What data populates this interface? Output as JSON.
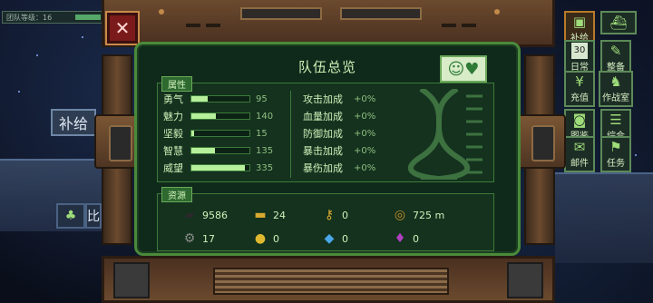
{
  "team": {
    "label": "团队等级：16",
    "progress": 0.35
  },
  "left_tab": {
    "label": "补给"
  },
  "side_glyph": "比",
  "panel": {
    "title": "队伍总览"
  },
  "attributes": {
    "tag": "属性",
    "items": [
      {
        "name": "勇气",
        "value": "95",
        "fill": 0.28
      },
      {
        "name": "魅力",
        "value": "140",
        "fill": 0.42
      },
      {
        "name": "坚毅",
        "value": "15",
        "fill": 0.05
      },
      {
        "name": "智慧",
        "value": "135",
        "fill": 0.4
      },
      {
        "name": "威望",
        "value": "335",
        "fill": 0.92
      }
    ],
    "bonuses": [
      {
        "name": "攻击加成",
        "value": "+0%"
      },
      {
        "name": "血量加成",
        "value": "+0%"
      },
      {
        "name": "防御加成",
        "value": "+0%"
      },
      {
        "name": "暴击加成",
        "value": "+0%"
      },
      {
        "name": "暴伤加成",
        "value": "+0%"
      }
    ]
  },
  "resources": {
    "tag": "资源",
    "items": [
      {
        "icon": "ore-icon",
        "value": "9586",
        "color": "#2a2a2a"
      },
      {
        "icon": "gold-bar-icon",
        "value": "24",
        "color": "#d8a830"
      },
      {
        "icon": "key-icon",
        "value": "0",
        "color": "#d8a830"
      },
      {
        "icon": "compass-icon",
        "value": "725 m",
        "color": "#c8902a"
      },
      {
        "icon": "gear-coin-icon",
        "value": "17",
        "color": "#8a8a8a"
      },
      {
        "icon": "lock-coin-icon",
        "value": "0",
        "color": "#e0b830"
      },
      {
        "icon": "crystal-icon",
        "value": "0",
        "color": "#4aa8e8"
      },
      {
        "icon": "gem-icon",
        "value": "0",
        "color": "#b040c0"
      }
    ]
  },
  "right_menu": [
    {
      "label": "补给",
      "icon": "supply-icon",
      "glyph": "▣"
    },
    {
      "label": "日常",
      "icon": "calendar-icon",
      "glyph": "30"
    },
    {
      "label": "整备",
      "icon": "wrench-icon",
      "glyph": "✎"
    },
    {
      "label": "充值",
      "icon": "coin-icon",
      "glyph": "¥"
    },
    {
      "label": "作战室",
      "icon": "chess-icon",
      "glyph": "♞"
    },
    {
      "label": "图鉴",
      "icon": "camera-icon",
      "glyph": "◙"
    },
    {
      "label": "综合",
      "icon": "clipboard-icon",
      "glyph": "☰"
    },
    {
      "label": "邮件",
      "icon": "mail-icon",
      "glyph": "✉"
    },
    {
      "label": "任务",
      "icon": "flag-icon",
      "glyph": "⚑"
    }
  ],
  "colors": {
    "screen_bg": "#0f2a1a",
    "accent_green": "#b6f09a",
    "frame_brown": "#6b4a2e",
    "close_red": "#7a1a1a"
  }
}
